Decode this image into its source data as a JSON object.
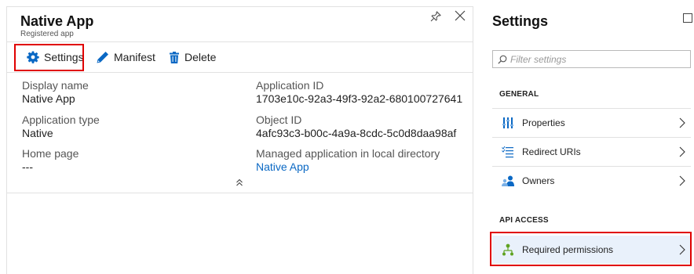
{
  "app_blade": {
    "title": "Native App",
    "subtitle": "Registered app",
    "toolbar": {
      "settings_label": "Settings",
      "manifest_label": "Manifest",
      "delete_label": "Delete"
    },
    "properties": {
      "display_name_label": "Display name",
      "display_name_value": "Native App",
      "application_type_label": "Application type",
      "application_type_value": "Native",
      "home_page_label": "Home page",
      "home_page_value": "---",
      "application_id_label": "Application ID",
      "application_id_value": "1703e10c-92a3-49f3-92a2-680100727641",
      "object_id_label": "Object ID",
      "object_id_value": "4afc93c3-b00c-4a9a-8cdc-5c0d8daa98af",
      "managed_app_label": "Managed application in local directory",
      "managed_app_link": "Native App"
    }
  },
  "settings_blade": {
    "title": "Settings",
    "filter_placeholder": "Filter settings",
    "general_heading": "GENERAL",
    "api_access_heading": "API ACCESS",
    "items": [
      {
        "label": "Properties",
        "icon": "properties-icon"
      },
      {
        "label": "Redirect URIs",
        "icon": "redirect-uris-icon"
      },
      {
        "label": "Owners",
        "icon": "owners-icon"
      },
      {
        "label": "Required permissions",
        "icon": "required-permissions-icon"
      }
    ]
  },
  "colors": {
    "accent": "#0a68c4",
    "highlight": "#e00000",
    "selected_bg": "#e9f1fb"
  }
}
